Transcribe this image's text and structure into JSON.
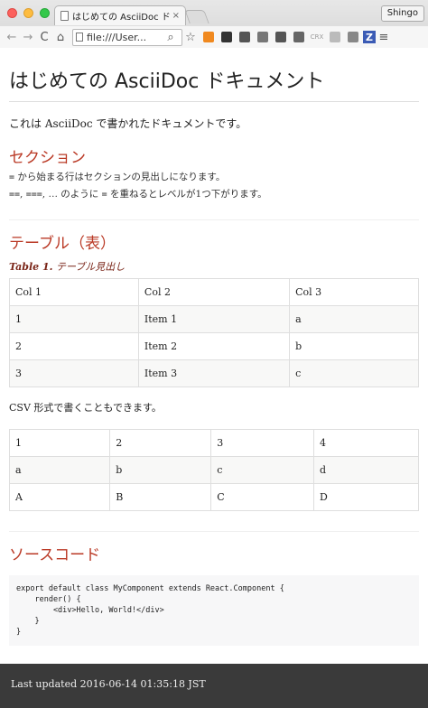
{
  "browser": {
    "tab_title": "はじめての AsciiDoc ドキュ",
    "tab_close": "×",
    "profile_name": "Shingo",
    "url": "file:///User...",
    "nav_back": "←",
    "nav_forward": "→",
    "nav_reload": "C",
    "nav_home": "⌂",
    "zoom_glyph": "⌕",
    "star_glyph": "☆",
    "menu_glyph": "≡",
    "extensions": [
      {
        "name": "ext-orange-icon",
        "color": "#f0891f",
        "glyph": ""
      },
      {
        "name": "ext-mask-icon",
        "color": "#333333",
        "glyph": ""
      },
      {
        "name": "ext-eye-icon",
        "color": "#555555",
        "glyph": ""
      },
      {
        "name": "ext-cast-icon",
        "color": "#777777",
        "glyph": ""
      },
      {
        "name": "ext-clipboard-icon",
        "color": "#555555",
        "glyph": ""
      },
      {
        "name": "ext-copy-icon",
        "color": "#666666",
        "glyph": ""
      },
      {
        "name": "ext-crx-icon",
        "color": "#cfcfcf",
        "glyph": "CRX"
      },
      {
        "name": "ext-page-icon",
        "color": "#bbbbbb",
        "glyph": ""
      },
      {
        "name": "ext-paint-icon",
        "color": "#888888",
        "glyph": ""
      },
      {
        "name": "ext-z-icon",
        "color": "#3b5bb5",
        "glyph": "Z"
      }
    ]
  },
  "doc": {
    "title": "はじめての AsciiDoc ドキュメント",
    "lead": "これは AsciiDoc で書かれたドキュメントです。",
    "section1": {
      "heading": "セクション",
      "line1_code": "=",
      "line1_text": " から始まる行はセクションの見出しになります。",
      "line2_code1": "==",
      "line2_sep1": ", ",
      "line2_code2": "===",
      "line2_sep2": ", … のように ",
      "line2_code3": "=",
      "line2_text": " を重ねるとレベルが1つ下がります。"
    },
    "section2": {
      "heading": "テーブル（表）",
      "caption_label": "Table 1.",
      "caption_text": " テーブル見出し",
      "table1": [
        [
          "Col 1",
          "Col 2",
          "Col 3"
        ],
        [
          "1",
          "Item 1",
          "a"
        ],
        [
          "2",
          "Item 2",
          "b"
        ],
        [
          "3",
          "Item 3",
          "c"
        ]
      ],
      "csv_note": "CSV 形式で書くこともできます。",
      "table2": [
        [
          "1",
          "2",
          "3",
          "4"
        ],
        [
          "a",
          "b",
          "c",
          "d"
        ],
        [
          "A",
          "B",
          "C",
          "D"
        ]
      ]
    },
    "section3": {
      "heading": "ソースコード",
      "code": "export default class MyComponent extends React.Component {\n    render() {\n        <div>Hello, World!</div>\n    }\n}"
    }
  },
  "footer": {
    "text": "Last updated 2016-06-14 01:35:18 JST"
  }
}
